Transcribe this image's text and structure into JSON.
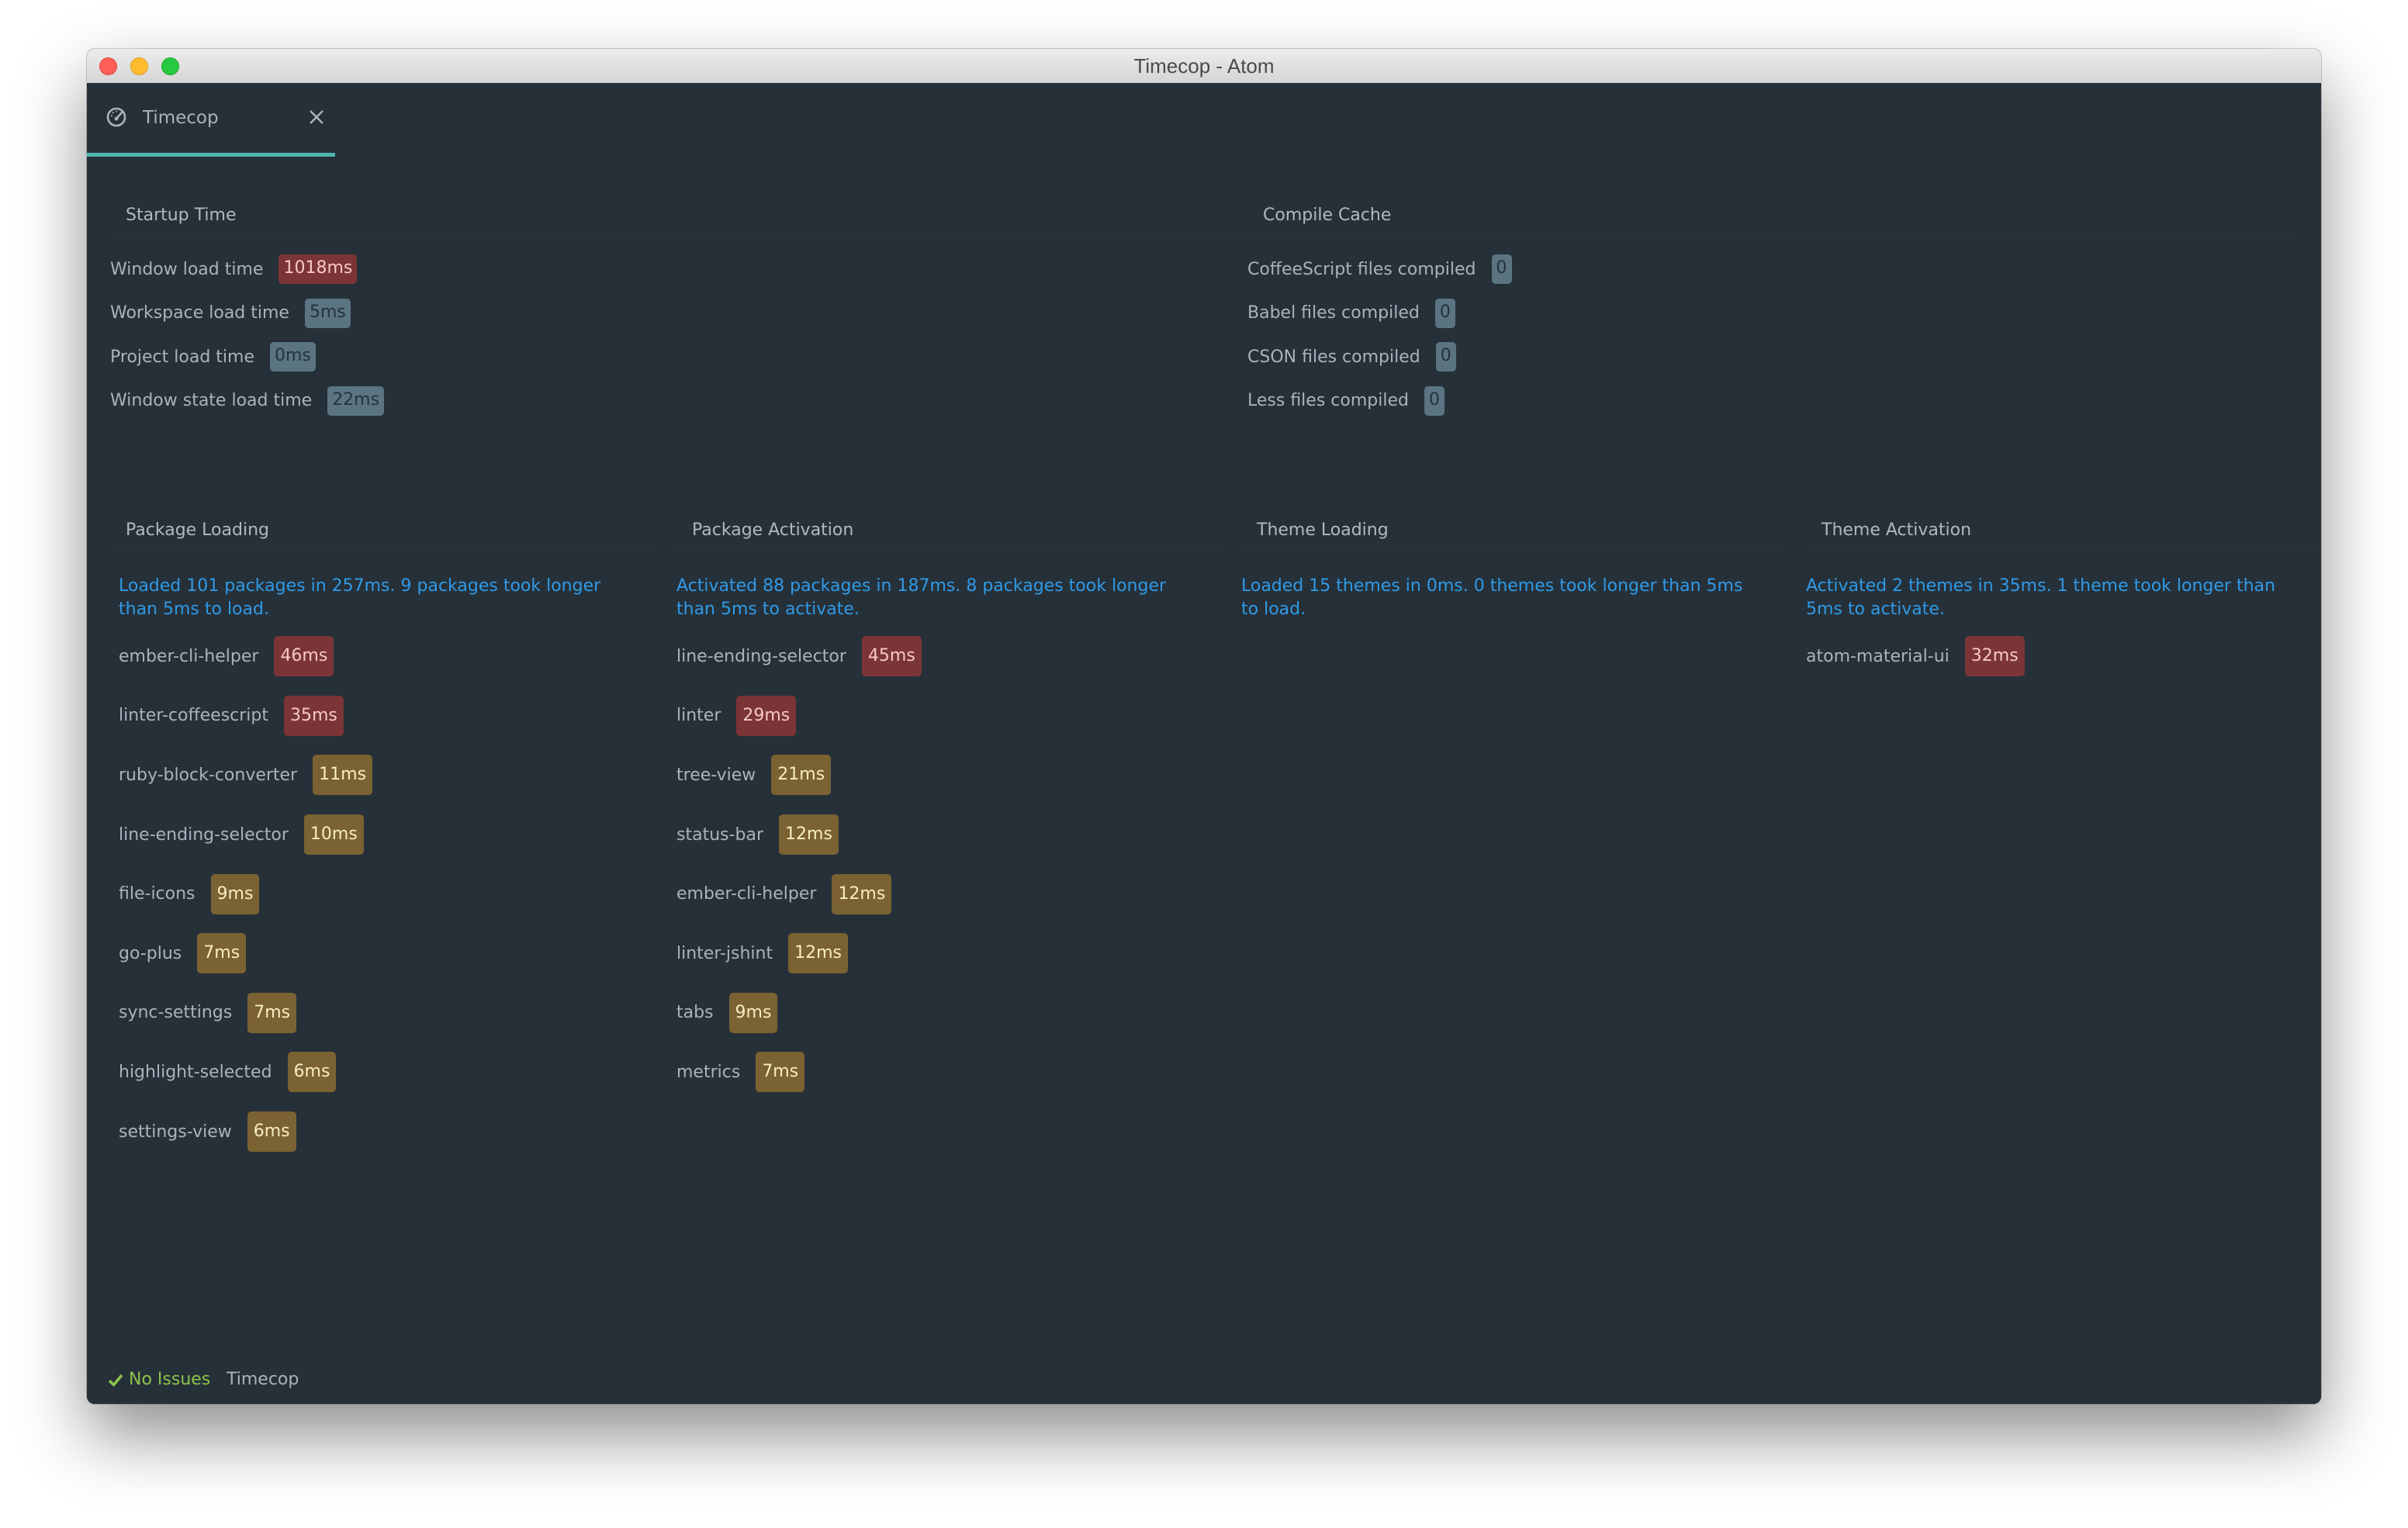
{
  "window": {
    "title": "Timecop - Atom",
    "controls": [
      "close",
      "minimize",
      "maximize"
    ]
  },
  "tab": {
    "icon": "dashboard-icon",
    "title": "Timecop",
    "close_icon": "close-icon",
    "accent_color": "#4db6ac"
  },
  "colors": {
    "background": "#263039",
    "summary_text": "#2f9ae6",
    "badge_info": "#5a7482",
    "badge_warning": "#7b6232",
    "badge_error": "#7b3537",
    "status_ok": "#8bc34a"
  },
  "startup_time": {
    "title": "Startup Time",
    "rows": [
      {
        "label": "Window load time",
        "value": "1018ms",
        "level": "error"
      },
      {
        "label": "Workspace load time",
        "value": "5ms",
        "level": "info"
      },
      {
        "label": "Project load time",
        "value": "0ms",
        "level": "info"
      },
      {
        "label": "Window state load time",
        "value": "22ms",
        "level": "info"
      }
    ]
  },
  "compile_cache": {
    "title": "Compile Cache",
    "rows": [
      {
        "label": "CoffeeScript files compiled",
        "value": "0",
        "level": "info"
      },
      {
        "label": "Babel files compiled",
        "value": "0",
        "level": "info"
      },
      {
        "label": "CSON files compiled",
        "value": "0",
        "level": "info"
      },
      {
        "label": "Less files compiled",
        "value": "0",
        "level": "info"
      }
    ]
  },
  "package_loading": {
    "title": "Package Loading",
    "summary": "Loaded 101 packages in 257ms. 9 packages took longer than 5ms to load.",
    "rows": [
      {
        "label": "ember-cli-helper",
        "value": "46ms",
        "level": "error"
      },
      {
        "label": "linter-coffeescript",
        "value": "35ms",
        "level": "error"
      },
      {
        "label": "ruby-block-converter",
        "value": "11ms",
        "level": "warn"
      },
      {
        "label": "line-ending-selector",
        "value": "10ms",
        "level": "warn"
      },
      {
        "label": "file-icons",
        "value": "9ms",
        "level": "warn"
      },
      {
        "label": "go-plus",
        "value": "7ms",
        "level": "warn"
      },
      {
        "label": "sync-settings",
        "value": "7ms",
        "level": "warn"
      },
      {
        "label": "highlight-selected",
        "value": "6ms",
        "level": "warn"
      },
      {
        "label": "settings-view",
        "value": "6ms",
        "level": "warn"
      }
    ]
  },
  "package_activation": {
    "title": "Package Activation",
    "summary": "Activated 88 packages in 187ms. 8 packages took longer than 5ms to activate.",
    "rows": [
      {
        "label": "line-ending-selector",
        "value": "45ms",
        "level": "error"
      },
      {
        "label": "linter",
        "value": "29ms",
        "level": "error"
      },
      {
        "label": "tree-view",
        "value": "21ms",
        "level": "warn"
      },
      {
        "label": "status-bar",
        "value": "12ms",
        "level": "warn"
      },
      {
        "label": "ember-cli-helper",
        "value": "12ms",
        "level": "warn"
      },
      {
        "label": "linter-jshint",
        "value": "12ms",
        "level": "warn"
      },
      {
        "label": "tabs",
        "value": "9ms",
        "level": "warn"
      },
      {
        "label": "metrics",
        "value": "7ms",
        "level": "warn"
      }
    ]
  },
  "theme_loading": {
    "title": "Theme Loading",
    "summary": "Loaded 15 themes in 0ms. 0 themes took longer than 5ms to load.",
    "rows": []
  },
  "theme_activation": {
    "title": "Theme Activation",
    "summary": "Activated 2 themes in 35ms. 1 theme took longer than 5ms to activate.",
    "rows": [
      {
        "label": "atom-material-ui",
        "value": "32ms",
        "level": "error"
      }
    ]
  },
  "status_bar": {
    "linter_icon": "check-icon",
    "linter_status": "No Issues",
    "active_item": "Timecop"
  }
}
